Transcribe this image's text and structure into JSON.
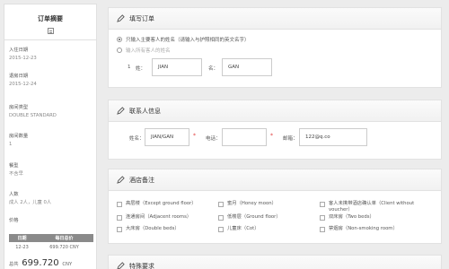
{
  "summary": {
    "title": "订单摘要",
    "checkin_label": "入住日期",
    "checkin_value": "2015-12-23",
    "checkout_label": "退房日期",
    "checkout_value": "2015-12-24",
    "room_type_label": "房间类型",
    "room_type_value": "DOUBLE STANDARD",
    "room_count_label": "房间数量",
    "room_count_value": "1",
    "meal_label": "餐型",
    "meal_value": "不含早",
    "guests_label": "人数",
    "guests_value": "成人 2人，儿童 0人",
    "price_label": "价格",
    "price_table": {
      "headers": [
        "日期",
        "每日总价"
      ],
      "rows": [
        [
          "12-23",
          "699.720 CNY"
        ]
      ]
    },
    "total_label": "总共",
    "total_amount": "699.720",
    "total_currency": "CNY"
  },
  "fill_order": {
    "title": "填写订单",
    "option_main": "只输入主要客人的姓名（请输入与护照相同的英文名字）",
    "option_all": "输入所有客人的姓名",
    "row_index": "1",
    "surname_label": "姓：",
    "surname_value": "JIAN",
    "given_label": "名：",
    "given_value": "GAN"
  },
  "contact": {
    "title": "联系人信息",
    "name_label": "姓名：",
    "name_value": "JIAN/GAN",
    "phone_label": "电话：",
    "phone_value": "",
    "email_label": "邮箱：",
    "email_value": "122@q.co",
    "required_mark": "*"
  },
  "remarks": {
    "title": "酒店备注",
    "options": [
      "高层楼（Except ground floor）",
      "蜜月（Honey moon）",
      "客人未携带酒店确认单（Client without voucher）",
      "连通房间（Adjacent rooms）",
      "低楼层（Ground floor）",
      "双床房（Two beds）",
      "大床房（Double beds）",
      "儿童床（Cot）",
      "禁烟房（Non-smoking room）"
    ]
  },
  "special": {
    "title": "特殊要求"
  }
}
